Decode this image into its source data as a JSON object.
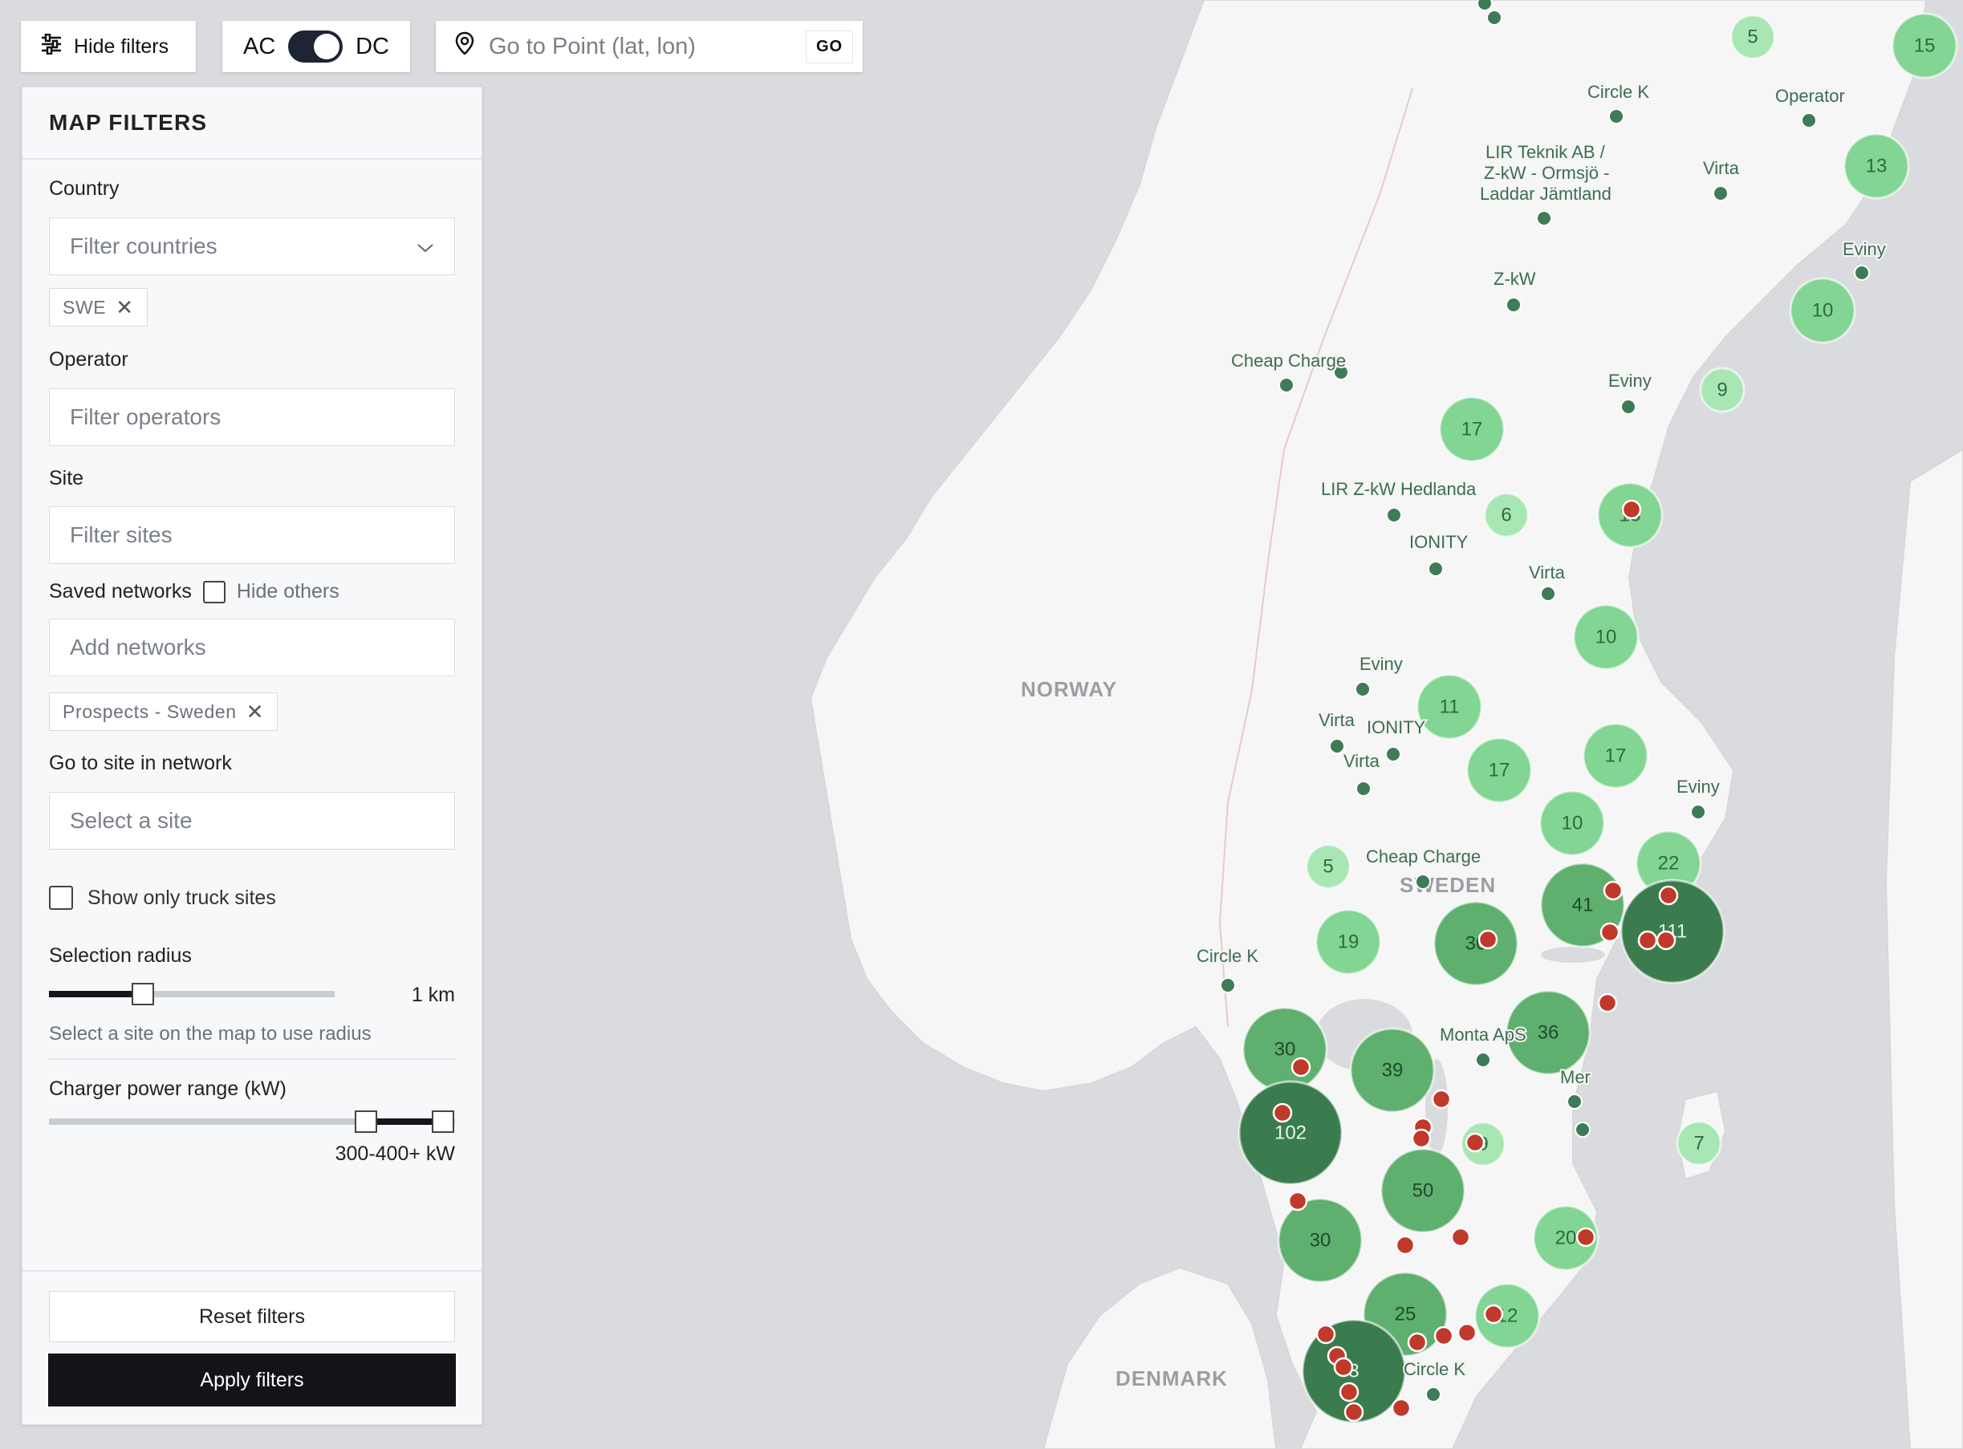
{
  "topbar": {
    "hide_filters_label": "Hide filters",
    "ac_label": "AC",
    "dc_label": "DC",
    "goto_placeholder": "Go to Point (lat, lon)",
    "go_label": "GO"
  },
  "panel": {
    "title": "MAP FILTERS",
    "country_label": "Country",
    "country_placeholder": "Filter countries",
    "country_chip": "SWE",
    "operator_label": "Operator",
    "operator_placeholder": "Filter operators",
    "site_label": "Site",
    "site_placeholder": "Filter sites",
    "saved_networks_label": "Saved networks",
    "hide_others_label": "Hide others",
    "networks_placeholder": "Add networks",
    "network_chip": "Prospects - Sweden",
    "goto_site_label": "Go to site in network",
    "goto_site_placeholder": "Select a site",
    "truck_sites_label": "Show only truck sites",
    "radius_label": "Selection radius",
    "radius_value": "1 km",
    "radius_fraction": 0.33,
    "radius_note": "Select a site on the map to use radius",
    "power_label": "Charger power range (kW)",
    "power_value": "300-400+ kW",
    "power_range_fraction": [
      0.78,
      0.97
    ],
    "reset_label": "Reset filters",
    "apply_label": "Apply filters"
  },
  "map": {
    "countries": [
      "NORWAY",
      "SWEDEN",
      "DENMARK"
    ],
    "operator_labels": [
      "Circle K",
      "Operator",
      "Virta",
      "LIR Teknik AB /",
      "Z-kW - Ormsjö -",
      "Laddar Jämtland",
      "Eviny",
      "Z-kW",
      "Cheap Charge",
      "Eviny",
      "LIR Z-kW Hedlanda",
      "IONITY",
      "Virta",
      "Eviny",
      "Virta",
      "IONITY",
      "Virta",
      "Eviny",
      "Cheap Charge",
      "Circle K",
      "Monta ApS",
      "Mer",
      "Circle K"
    ],
    "clusters": [
      {
        "count": "5"
      },
      {
        "count": "15"
      },
      {
        "count": "13"
      },
      {
        "count": "10"
      },
      {
        "count": "9"
      },
      {
        "count": "17"
      },
      {
        "count": "6"
      },
      {
        "count": "10"
      },
      {
        "count": "11"
      },
      {
        "count": "17"
      },
      {
        "count": "17"
      },
      {
        "count": "10"
      },
      {
        "count": "5"
      },
      {
        "count": "22"
      },
      {
        "count": "41"
      },
      {
        "count": "111"
      },
      {
        "count": "19"
      },
      {
        "count": "30"
      },
      {
        "count": "36"
      },
      {
        "count": "30"
      },
      {
        "count": "39"
      },
      {
        "count": "102"
      },
      {
        "count": "7"
      },
      {
        "count": "50"
      },
      {
        "count": "30"
      },
      {
        "count": "20"
      },
      {
        "count": "25"
      },
      {
        "count": "12"
      },
      {
        "count": "3"
      },
      {
        "count": "9"
      },
      {
        "count": "13"
      }
    ],
    "colors": {
      "water": "#d9dbde",
      "land": "#f5f5f5",
      "site": "#3e7b56",
      "prospect": "#c0392b"
    }
  }
}
